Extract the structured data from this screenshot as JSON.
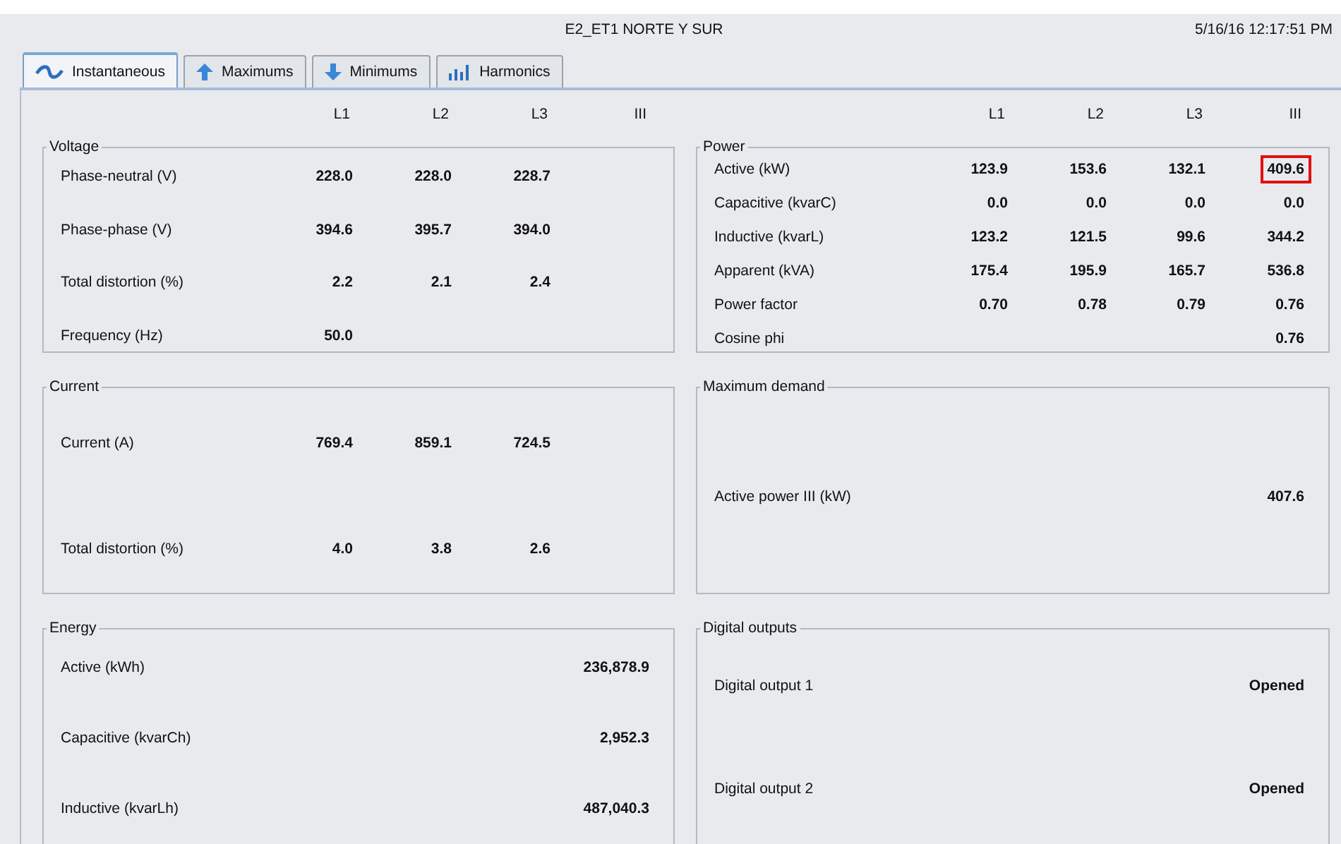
{
  "window": {
    "title": "E2_ET1 NORTE Y SUR",
    "timestamp": "5/16/16 12:17:51 PM"
  },
  "tabs": [
    {
      "label": "Instantaneous",
      "selected": true
    },
    {
      "label": "Maximums",
      "selected": false
    },
    {
      "label": "Minimums",
      "selected": false
    },
    {
      "label": "Harmonics",
      "selected": false
    }
  ],
  "left": {
    "columns": [
      "L1",
      "L2",
      "L3",
      "III"
    ],
    "sections": [
      {
        "title": "Voltage",
        "rows": [
          {
            "label": "Phase-neutral (V)",
            "l1": "228.0",
            "l2": "228.0",
            "l3": "228.7"
          },
          {
            "label": "Phase-phase (V)",
            "l1": "394.6",
            "l2": "395.7",
            "l3": "394.0"
          },
          {
            "label": "Total distortion (%)",
            "l1": "2.2",
            "l2": "2.1",
            "l3": "2.4"
          },
          {
            "label": "Frequency (Hz)",
            "l1": "50.0"
          }
        ]
      },
      {
        "title": "Current",
        "rows": [
          {
            "label": "Current (A)",
            "l1": "769.4",
            "l2": "859.1",
            "l3": "724.5"
          },
          {
            "label": "Total distortion (%)",
            "l1": "4.0",
            "l2": "3.8",
            "l3": "2.6"
          }
        ]
      },
      {
        "title": "Energy",
        "rows": [
          {
            "label": "Active (kWh)",
            "iii": "236,878.9"
          },
          {
            "label": "Capacitive (kvarCh)",
            "iii": "2,952.3"
          },
          {
            "label": "Inductive (kvarLh)",
            "iii": "487,040.3"
          }
        ]
      }
    ]
  },
  "right": {
    "columns": [
      "L1",
      "L2",
      "L3",
      "III"
    ],
    "sections": [
      {
        "title": "Power",
        "rows": [
          {
            "label": "Active (kW)",
            "l1": {
              "text": "123.9",
              "highlighted": false
            },
            "l2": {
              "text": "153.6",
              "highlighted": false
            },
            "l3": {
              "text": "132.1",
              "highlighted": false
            },
            "iii": {
              "text": "409.6",
              "highlighted": true
            }
          },
          {
            "label": "Capacitive (kvarC)",
            "l1": {
              "text": "0.0",
              "highlighted": false
            },
            "l2": {
              "text": "0.0",
              "highlighted": false
            },
            "l3": {
              "text": "0.0",
              "highlighted": false
            },
            "iii": {
              "text": "0.0",
              "highlighted": false
            }
          },
          {
            "label": "Inductive (kvarL)",
            "l1": {
              "text": "123.2",
              "highlighted": false
            },
            "l2": {
              "text": "121.5",
              "highlighted": false
            },
            "l3": {
              "text": "99.6",
              "highlighted": false
            },
            "iii": {
              "text": "344.2",
              "highlighted": false
            }
          },
          {
            "label": "Apparent (kVA)",
            "l1": {
              "text": "175.4",
              "highlighted": false
            },
            "l2": {
              "text": "195.9",
              "highlighted": false
            },
            "l3": {
              "text": "165.7",
              "highlighted": false
            },
            "iii": {
              "text": "536.8",
              "highlighted": false
            }
          },
          {
            "label": "Power factor",
            "l1": {
              "text": "0.70",
              "highlighted": false
            },
            "l2": {
              "text": "0.78",
              "highlighted": false
            },
            "l3": {
              "text": "0.79",
              "highlighted": false
            },
            "iii": {
              "text": "0.76",
              "highlighted": false
            }
          },
          {
            "label": "Cosine phi",
            "iii": {
              "text": "0.76",
              "highlighted": false
            }
          }
        ]
      },
      {
        "title": "Maximum demand",
        "rows": [
          {
            "label": "Active power III (kW)",
            "iii": "407.6"
          }
        ]
      },
      {
        "title": "Digital outputs",
        "rows": [
          {
            "label": "Digital output 1",
            "iii": "Opened"
          },
          {
            "label": "Digital output 2",
            "iii": "Opened"
          }
        ]
      }
    ]
  }
}
